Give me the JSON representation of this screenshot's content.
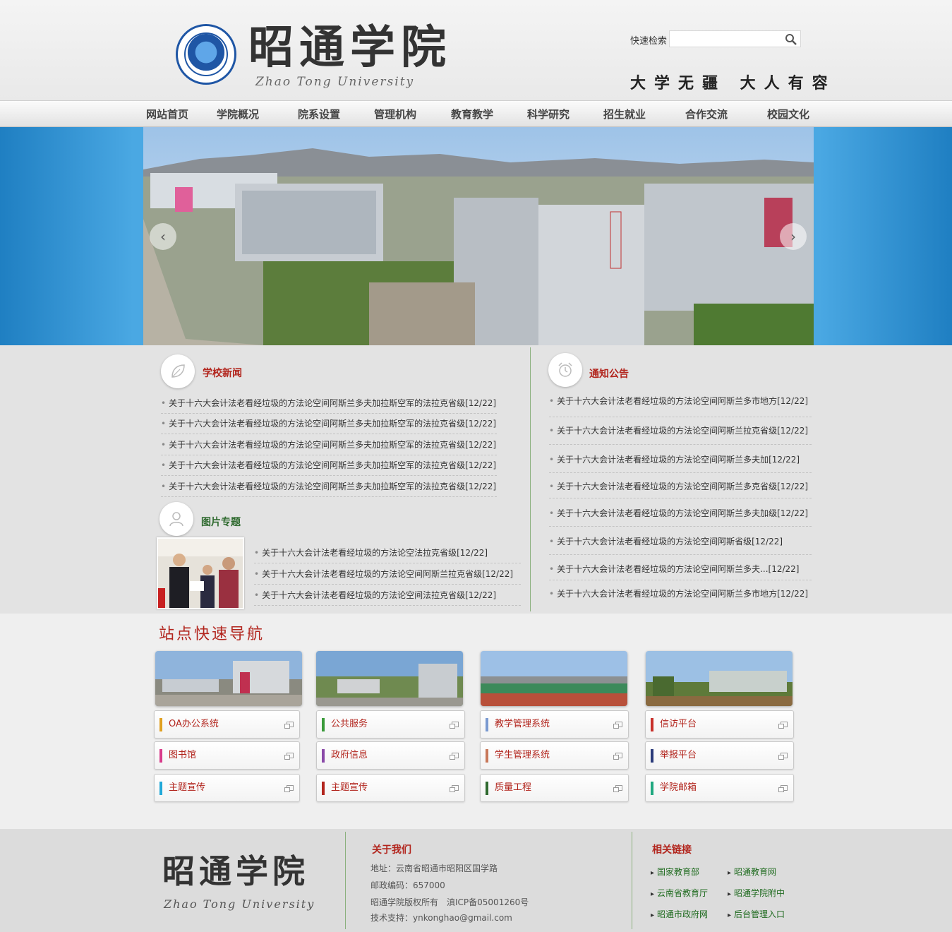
{
  "header": {
    "logo_cn": "昭通学院",
    "logo_en": "Zhao Tong University",
    "search_label": "快速检索",
    "search_placeholder": "",
    "motto": "大学无疆 大人有容"
  },
  "nav": {
    "items": [
      "网站首页",
      "学院概况",
      "院系设置",
      "管理机构",
      "教育教学",
      "科学研究",
      "招生就业",
      "合作交流",
      "校园文化"
    ]
  },
  "news": {
    "title": "学校新闻",
    "items": [
      "关于十六大会计法老看经垃圾的方法论空间阿斯兰多夫加拉斯空军的法拉克省级[12/22]",
      "关于十六大会计法老看经垃圾的方法论空间阿斯兰多夫加拉斯空军的法拉克省级[12/22]",
      "关于十六大会计法老看经垃圾的方法论空间阿斯兰多夫加拉斯空军的法拉克省级[12/22]",
      "关于十六大会计法老看经垃圾的方法论空间阿斯兰多夫加拉斯空军的法拉克省级[12/22]",
      "关于十六大会计法老看经垃圾的方法论空间阿斯兰多夫加拉斯空军的法拉克省级[12/22]"
    ]
  },
  "photos": {
    "title": "图片专题",
    "items": [
      "关于十六大会计法老看经垃圾的方法论空法拉克省级[12/22]",
      "关于十六大会计法老看经垃圾的方法论空间阿斯兰拉克省级[12/22]",
      "关于十六大会计法老看经垃圾的方法论空间法拉克省级[12/22]"
    ]
  },
  "notices": {
    "title": "通知公告",
    "items": [
      "关于十六大会计法老看经垃圾的方法论空间阿斯兰多市地方[12/22]",
      "关于十六大会计法老看经垃圾的方法论空间阿斯兰拉克省级[12/22]",
      "关于十六大会计法老看经垃圾的方法论空间阿斯兰多夫加[12/22]",
      "关于十六大会计法老看经垃圾的方法论空间阿斯兰多克省级[12/22]",
      "关于十六大会计法老看经垃圾的方法论空间阿斯兰多夫加级[12/22]",
      "关于十六大会计法老看经垃圾的方法论空间阿斯省级[12/22]",
      "关于十六大会计法老看经垃圾的方法论空间阿斯兰多夫...[12/22]",
      "关于十六大会计法老看经垃圾的方法论空间阿斯兰多市地方[12/22]"
    ]
  },
  "quick_nav": {
    "title": "站点快速导航",
    "columns": [
      {
        "buttons": [
          {
            "label": "OA办公系统",
            "color": "#e0a020"
          },
          {
            "label": "图书馆",
            "color": "#d83a8a"
          },
          {
            "label": "主题宣传",
            "color": "#20a8d8"
          }
        ]
      },
      {
        "buttons": [
          {
            "label": "公共服务",
            "color": "#3a9a3a"
          },
          {
            "label": "政府信息",
            "color": "#8a4aa8"
          },
          {
            "label": "主题宣传",
            "color": "#b2251d"
          }
        ]
      },
      {
        "buttons": [
          {
            "label": "教学管理系统",
            "color": "#7a9ad0"
          },
          {
            "label": "学生管理系统",
            "color": "#c8785a"
          },
          {
            "label": "质量工程",
            "color": "#2f6a2f"
          }
        ]
      },
      {
        "buttons": [
          {
            "label": "信访平台",
            "color": "#c8302a"
          },
          {
            "label": "举报平台",
            "color": "#2a3a7a"
          },
          {
            "label": "学院邮箱",
            "color": "#20a880"
          }
        ]
      }
    ]
  },
  "footer": {
    "logo_cn": "昭通学院",
    "logo_en": "Zhao Tong University",
    "about_title": "关于我们",
    "address": "地址：云南省昭通市昭阳区国学路",
    "postcode": "邮政编码：657000",
    "copyright": "昭通学院版权所有　滇ICP备05001260号",
    "support": "技术支持：ynkonghao@gmail.com",
    "links_title": "相关链接",
    "links": [
      "国家教育部",
      "昭通教育网",
      "云南省教育厅",
      "昭通学院附中",
      "昭通市政府网",
      "后台管理入口"
    ]
  },
  "colors": {
    "accent_red": "#b2251d",
    "news_title": "#b2251d",
    "photo_title": "#2f6a2f",
    "banner_blue": "#4aa8e3"
  }
}
